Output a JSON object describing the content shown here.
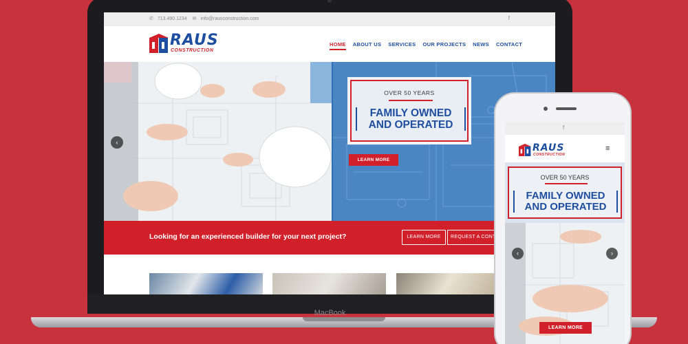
{
  "colors": {
    "background": "#c8323c",
    "brand_red": "#d1202a",
    "brand_blue": "#1e4ea0",
    "blueprint_blue": "#4a86c4"
  },
  "laptop": {
    "brand_label": "MacBook",
    "site": {
      "topbar": {
        "phone": "713.490.1234",
        "email": "info@rausconstruction.com",
        "phone_icon": "phone-icon",
        "email_icon": "envelope-icon",
        "social_icon": "facebook-icon",
        "social_glyph": "f"
      },
      "logo": {
        "name": "RAUS",
        "sub": "CONSTRUCTION"
      },
      "nav": [
        "HOME",
        "ABOUT US",
        "SERVICES",
        "OUR PROJECTS",
        "NEWS",
        "CONTACT"
      ],
      "active_nav": "HOME",
      "hero": {
        "eyebrow": "OVER 50 YEARS",
        "title_line1": "FAMILY OWNED",
        "title_line2": "AND OPERATED",
        "button": "LEARN MORE",
        "prev_glyph": "‹"
      },
      "cta": {
        "text": "Looking for an experienced builder for your next project?",
        "button1": "LEARN MORE",
        "button2": "REQUEST A CONTACT"
      }
    }
  },
  "phone": {
    "social_glyph": "f",
    "logo": {
      "name": "RAUS",
      "sub": "CONSTRUCTION"
    },
    "menu_glyph": "≡",
    "hero": {
      "eyebrow": "OVER 50 YEARS",
      "title_line1": "FAMILY OWNED",
      "title_line2": "AND OPERATED"
    },
    "prev_glyph": "‹",
    "next_glyph": "›",
    "button": "LEARN MORE"
  }
}
